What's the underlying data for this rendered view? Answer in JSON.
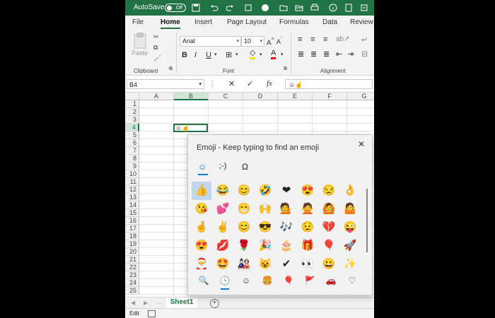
{
  "titlebar": {
    "autosave_label": "AutoSave",
    "autosave_state": "Off",
    "accent_color": "#217346"
  },
  "tabs": [
    "File",
    "Home",
    "Insert",
    "Page Layout",
    "Formulas",
    "Data",
    "Review"
  ],
  "active_tab": "Home",
  "ribbon": {
    "clipboard": {
      "paste_label": "Paste",
      "group_label": "Clipboard"
    },
    "font": {
      "family": "Arial",
      "size": "10",
      "group_label": "Font",
      "bold": "B",
      "italic": "I",
      "underline": "U"
    },
    "alignment": {
      "group_label": "Alignment"
    }
  },
  "formula_bar": {
    "name_box": "B4",
    "cancel_icon": "✕",
    "enter_icon": "✓",
    "fx": "fx",
    "value": "☺☝"
  },
  "grid": {
    "columns": [
      "A",
      "B",
      "C",
      "D",
      "E",
      "F",
      "G"
    ],
    "rows": [
      "1",
      "2",
      "3",
      "4",
      "5",
      "6",
      "7",
      "8",
      "9",
      "10",
      "11",
      "12",
      "13",
      "14",
      "15",
      "16",
      "17",
      "18",
      "19",
      "20",
      "21",
      "22",
      "23",
      "24",
      "25"
    ],
    "active_cell_value": "☺☝"
  },
  "sheets": {
    "tab": "Sheet1",
    "add": "+"
  },
  "status": {
    "mode": "Edit"
  },
  "emoji_panel": {
    "title": "Emoji - Keep typing to find an emoji",
    "close": "✕",
    "tabs": [
      "☺",
      ";-)",
      "Ω"
    ],
    "emojis": [
      "👍",
      "😂",
      "😊",
      "🤣",
      "❤",
      "😍",
      "😒",
      "👌",
      "😘",
      "💕",
      "😁",
      "🙌",
      "💁",
      "🙅",
      "🙆",
      "🤷",
      "🤞",
      "✌",
      "😊",
      "😎",
      "🎶",
      "😟",
      "💔",
      "😜",
      "😍",
      "💋",
      "🌹",
      "🎉",
      "🎂",
      "🎁",
      "🎈",
      "🚀",
      "🎅",
      "🤩",
      "🎎",
      "😺",
      "✔",
      "👀",
      "😀",
      "✨"
    ],
    "categories": [
      "🔍",
      "🕓",
      "☺",
      "🍔",
      "🎈",
      "🚩",
      "🚗",
      "♡"
    ]
  }
}
